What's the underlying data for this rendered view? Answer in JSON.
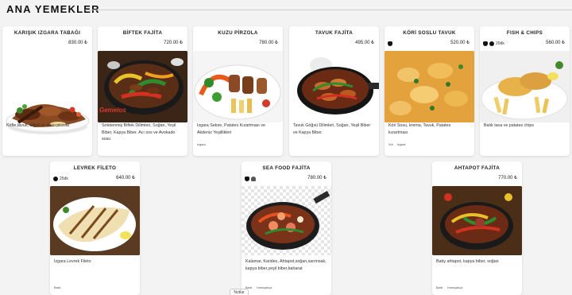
{
  "section": {
    "title": "ANA YEMEKLER"
  },
  "currency": "₺",
  "top_cards": [
    {
      "title": "KARIŞIK IZGARA TABAĞI",
      "price": "830.00 ₺",
      "description": "Köfte,tavuk, biftek ve kuzu pirzola",
      "tags": [],
      "meta": []
    },
    {
      "title": "BİFTEK FAJİTA",
      "price": "720.00 ₺",
      "description": "Sotelenmiş Biftek Dilimleri, Soğan, Yeşil Biber, Kapya Biber. Acı sos ve Avokado sosu",
      "tags": [],
      "meta": [],
      "image_watermark": "Gemelos"
    },
    {
      "title": "KUZU PİRZOLA",
      "price": "780.00 ₺",
      "description": "Izgara Sebze, Patates Kızartması ve Akdeniz Yeşillikleri",
      "tags": [
        "Izgara"
      ],
      "meta": []
    },
    {
      "title": "TAVUK FAJİTA",
      "price": "495.00 ₺",
      "description": "Tavuk Göğsü Dilimleri, Soğan, Yeşil Biber ve Kapya Biber.",
      "tags": [],
      "meta": []
    },
    {
      "title": "KÖRİ SOSLU TAVUK",
      "price": "520.00 ₺",
      "description": "Köri Sosu, krema, Tavuk, Patates kızartması",
      "tags": [
        "Süt",
        "Izgara"
      ],
      "meta": [
        {
          "icon": "hand-icon",
          "text": ""
        }
      ]
    },
    {
      "title": "FISH & CHIPS",
      "price": "560.00 ₺",
      "description": "Balık tava ve patates chips",
      "tags": [],
      "meta": [
        {
          "icon": "hand-icon",
          "text": ""
        },
        {
          "icon": "clock-icon",
          "text": "20dk"
        }
      ]
    }
  ],
  "bottom_cards": [
    {
      "title": "LEVREK FİLETO",
      "price": "640.00 ₺",
      "description": "Izgara Levrek Fileto",
      "tags": [
        "Balık"
      ],
      "meta": [
        {
          "icon": "clock-icon",
          "text": "25dk"
        }
      ]
    },
    {
      "title": "SEA FOOD FAJİTA",
      "price": "780.00 ₺",
      "description": "Kalamar, Karides, Ahtapot,soğan,sarımsak, kapya biber,yeşil biber,baharat",
      "tags": [
        "Balık",
        "Yumuşakça"
      ],
      "meta": [
        {
          "icon": "hand-icon",
          "text": ""
        },
        {
          "icon": "shell-icon",
          "text": ""
        }
      ]
    },
    {
      "title": "AHTAPOT FAJİTA",
      "price": "770.00 ₺",
      "description": "Baby ahtapot, kapya biber, soğan",
      "tags": [
        "Balık",
        "Yumuşakça"
      ],
      "meta": []
    }
  ],
  "notes_tab": {
    "label": "Notlar"
  },
  "colors": {
    "background": "#f3f3f3",
    "card": "#ffffff",
    "title": "#111111",
    "watermark": "#d9382c"
  }
}
